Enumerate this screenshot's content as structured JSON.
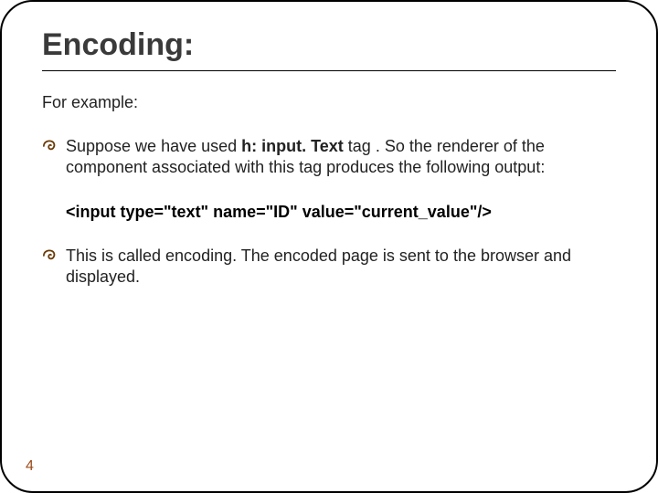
{
  "title": "Encoding:",
  "subhead": "For example:",
  "bullets": [
    {
      "pre": "Suppose we have used ",
      "bold": "h: input. Text",
      "post": " tag . So the renderer of the component associated with this tag produces the following output:"
    },
    {
      "pre": "This is called encoding. The encoded page is sent to the browser and displayed.",
      "bold": "",
      "post": ""
    }
  ],
  "code_line": "<input type=\"text\" name=\"ID\" value=\"current_value\"/>",
  "page_number": "4"
}
